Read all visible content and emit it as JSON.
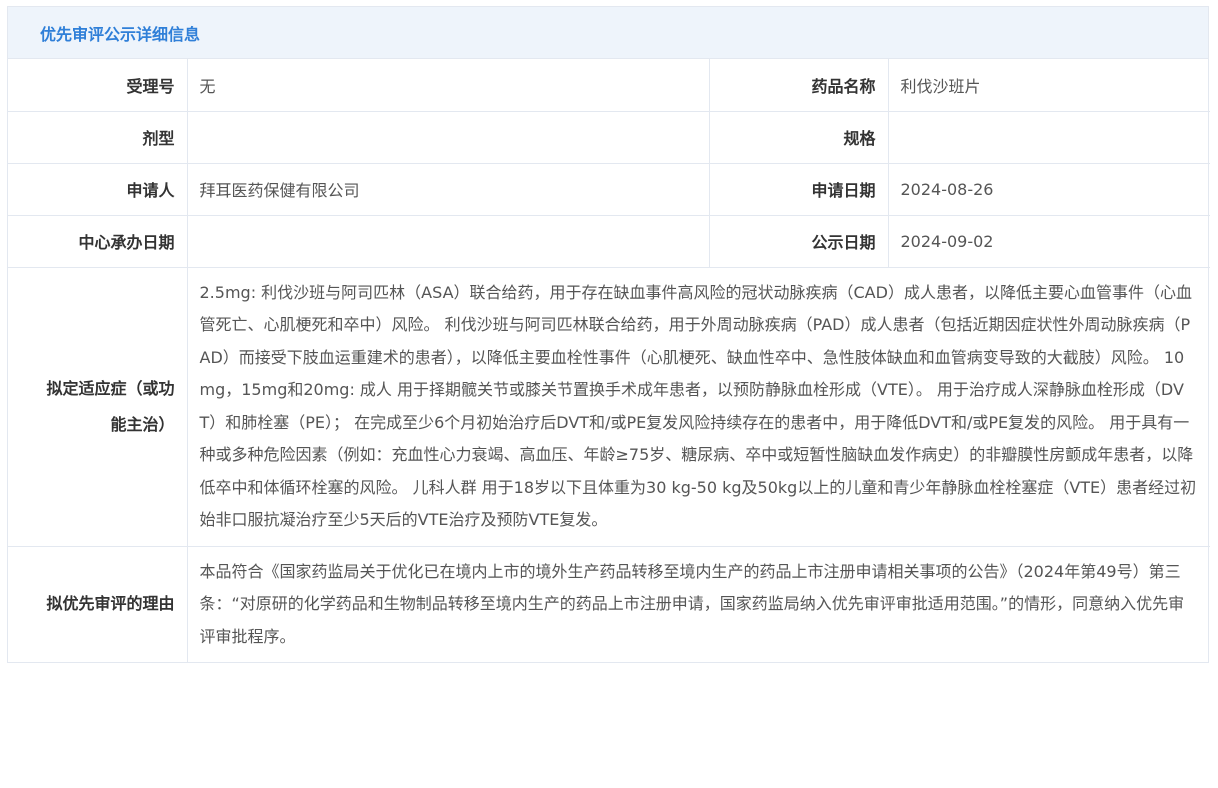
{
  "header": {
    "title": "优先审评公示详细信息"
  },
  "rows": {
    "accept_no_label": "受理号",
    "accept_no_value": "无",
    "drug_name_label": "药品名称",
    "drug_name_value": "利伐沙班片",
    "dosage_form_label": "剂型",
    "dosage_form_value": "",
    "spec_label": "规格",
    "spec_value": "",
    "applicant_label": "申请人",
    "applicant_value": "拜耳医药保健有限公司",
    "apply_date_label": "申请日期",
    "apply_date_value": "2024-08-26",
    "center_date_label": "中心承办日期",
    "center_date_value": "",
    "publish_date_label": "公示日期",
    "publish_date_value": "2024-09-02",
    "indication_label": "拟定适应症（或功能主治）",
    "indication_value": "2.5mg: 利伐沙班与阿司匹林（ASA）联合给药，用于存在缺血事件高风险的冠状动脉疾病（CAD）成人患者，以降低主要心血管事件（心血管死亡、心肌梗死和卒中）风险。 利伐沙班与阿司匹林联合给药，用于外周动脉疾病（PAD）成人患者（包括近期因症状性外周动脉疾病（PAD）而接受下肢血运重建术的患者），以降低主要血栓性事件（心肌梗死、缺血性卒中、急性肢体缺血和血管病变导致的大截肢）风险。 10mg，15mg和20mg: 成人 用于择期髋关节或膝关节置换手术成年患者，以预防静脉血栓形成（VTE）。 用于治疗成人深静脉血栓形成（DVT）和肺栓塞（PE）； 在完成至少6个月初始治疗后DVT和/或PE复发风险持续存在的患者中，用于降低DVT和/或PE复发的风险。 用于具有一种或多种危险因素（例如：充血性心力衰竭、高血压、年龄≥75岁、糖尿病、卒中或短暂性脑缺血发作病史）的非瓣膜性房颤成年患者，以降低卒中和体循环栓塞的风险。 儿科人群 用于18岁以下且体重为30 kg-50 kg及50kg以上的儿童和青少年静脉血栓栓塞症（VTE）患者经过初始非口服抗凝治疗至少5天后的VTE治疗及预防VTE复发。",
    "reason_label": "拟优先审评的理由",
    "reason_value": "本品符合《国家药监局关于优化已在境内上市的境外生产药品转移至境内生产的药品上市注册申请相关事项的公告》（2024年第49号）第三条：“对原研的化学药品和生物制品转移至境内生产的药品上市注册申请，国家药监局纳入优先审评审批适用范围。”的情形，同意纳入优先审评审批程序。"
  }
}
